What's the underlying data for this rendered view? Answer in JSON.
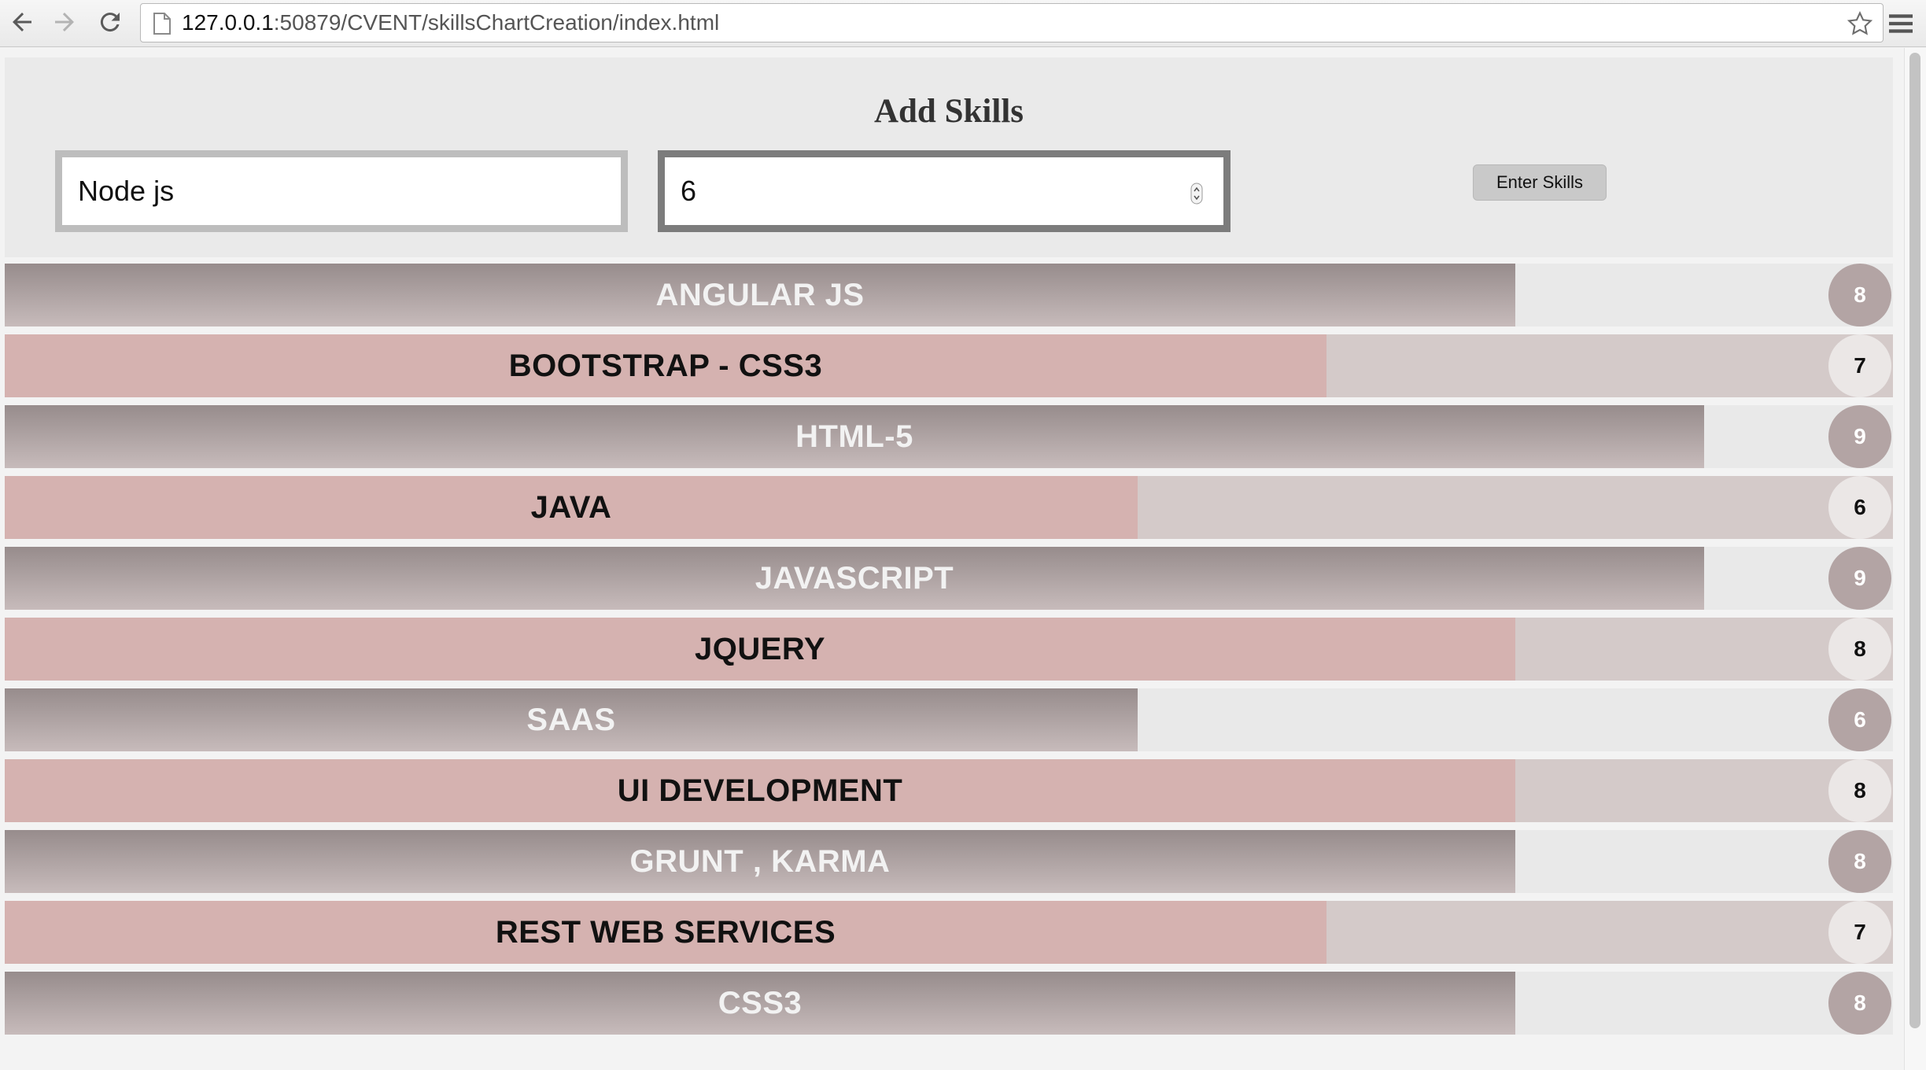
{
  "browser": {
    "url_host": "127.0.0.1",
    "url_rest": ":50879/CVENT/skillsChartCreation/index.html"
  },
  "form": {
    "title": "Add Skills",
    "skill_name_value": "Node js",
    "skill_level_value": "6",
    "submit_label": "Enter Skills"
  },
  "chart_data": {
    "type": "bar",
    "orientation": "horizontal",
    "max_value": 10,
    "categories": [
      "ANGULAR JS",
      "BOOTSTRAP - CSS3",
      "HTML-5",
      "JAVA",
      "JAVASCRIPT",
      "JQUERY",
      "SAAS",
      "UI DEVELOPMENT",
      "GRUNT , KARMA",
      "REST WEB SERVICES",
      "CSS3"
    ],
    "values": [
      8,
      7,
      9,
      6,
      9,
      8,
      6,
      8,
      8,
      7,
      8
    ],
    "value_labels": [
      "8",
      "7",
      "9",
      "6",
      "9",
      "8",
      "6",
      "8",
      "8",
      "7",
      "8"
    ]
  }
}
